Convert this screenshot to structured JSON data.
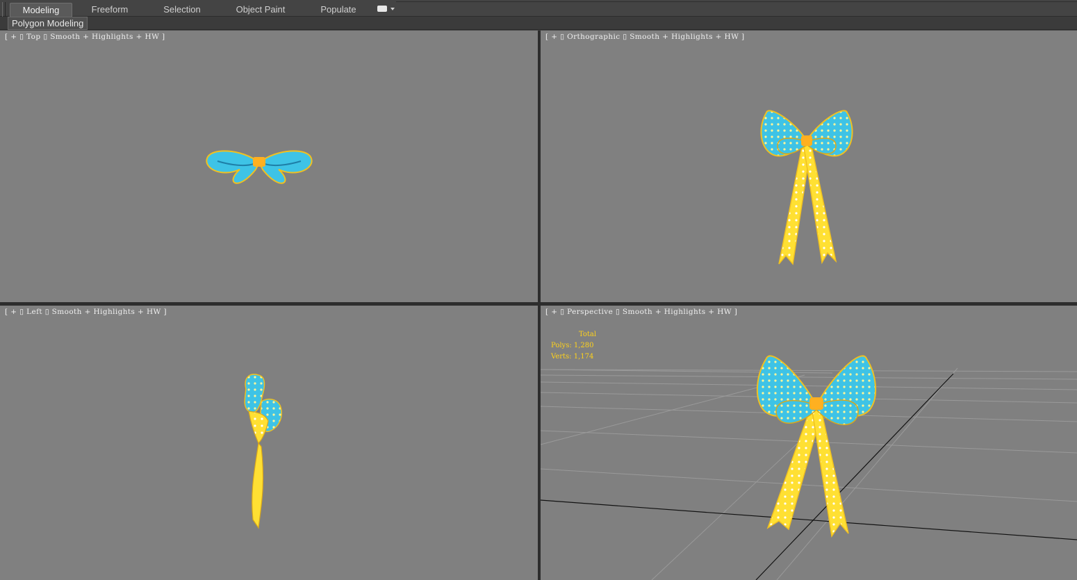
{
  "ribbon": {
    "tabs": [
      {
        "label": "Modeling",
        "active": true
      },
      {
        "label": "Freeform",
        "active": false
      },
      {
        "label": "Selection",
        "active": false
      },
      {
        "label": "Object Paint",
        "active": false
      },
      {
        "label": "Populate",
        "active": false
      }
    ],
    "panel_label": "Polygon Modeling"
  },
  "viewports": {
    "top": {
      "plus": "+",
      "view": "Top",
      "shading": "Smooth + Highlights + HW"
    },
    "orthographic": {
      "plus": "+",
      "view": "Orthographic",
      "shading": "Smooth + Highlights + HW"
    },
    "left": {
      "plus": "+",
      "view": "Left",
      "shading": "Smooth + Highlights + HW"
    },
    "perspective": {
      "plus": "+",
      "view": "Perspective",
      "shading": "Smooth + Highlights + HW",
      "stats": {
        "title": "Total",
        "polys": "Polys: 1,280",
        "verts": "Verts: 1,174"
      }
    }
  },
  "colors": {
    "viewport_bg": "#808080",
    "bow_blue": "#3ec3e6",
    "bow_yellow": "#ffe033",
    "stats_text": "#ffd21a"
  }
}
